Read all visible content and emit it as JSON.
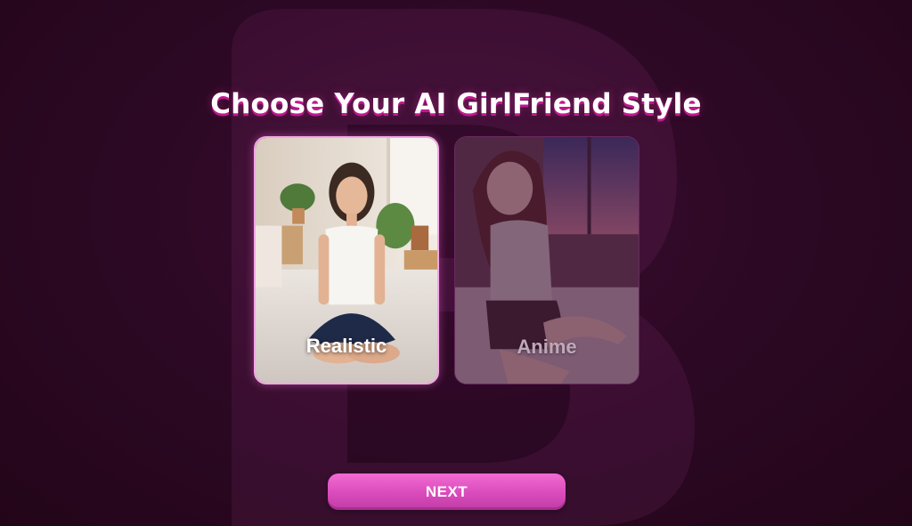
{
  "page": {
    "title": "Choose Your AI GirlFriend Style"
  },
  "styles": [
    {
      "id": "realistic",
      "label": "Realistic",
      "selected": true
    },
    {
      "id": "anime",
      "label": "Anime",
      "selected": false
    }
  ],
  "actions": {
    "next_label": "NEXT"
  },
  "colors": {
    "background": "#2b0823",
    "accent": "#e055c4",
    "selected_border": "#f3a6e6",
    "title_shadow": "#c2188f"
  },
  "icons": {
    "background_logo": "brand-logo-watermark"
  }
}
